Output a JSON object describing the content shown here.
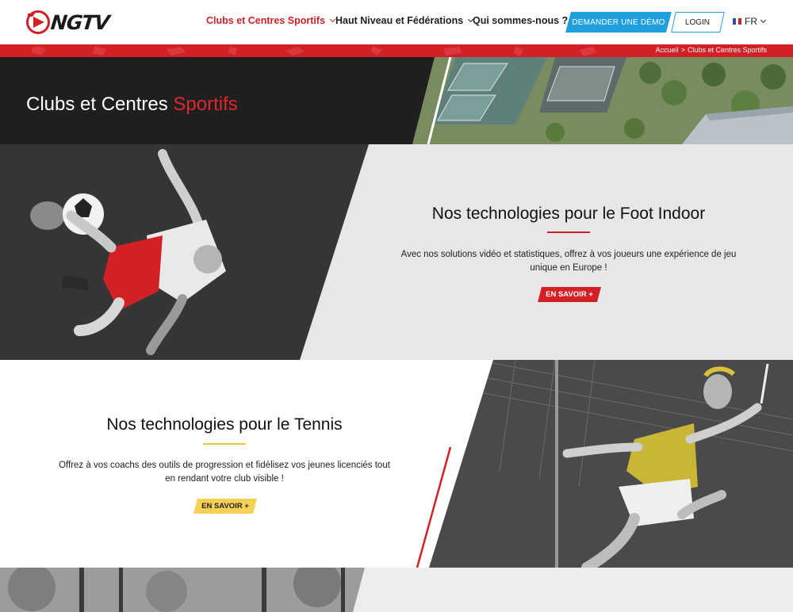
{
  "header": {
    "logo_text": "NGTV",
    "nav": [
      {
        "label": "Clubs et Centres Sportifs",
        "active": true,
        "has_dropdown": true
      },
      {
        "label": "Haut Niveau et Fédérations",
        "active": false,
        "has_dropdown": true
      },
      {
        "label": "Qui sommes-nous ?",
        "active": false,
        "has_dropdown": false
      }
    ],
    "demo_button": "DEMANDER UNE DÉMO",
    "login_button": "LOGIN",
    "language": "FR"
  },
  "breadcrumb": {
    "home": "Accueil",
    "separator": ">",
    "current": "Clubs et Centres Sportifs"
  },
  "hero": {
    "title_main": "Clubs et Centres",
    "title_accent": "Sportifs"
  },
  "sections": [
    {
      "id": "foot-indoor",
      "title": "Nos technologies pour le Foot Indoor",
      "text_line1": "Avec nos solutions vidéo et statistiques, offrez à vos joueurs une expérience de jeu",
      "text_line2": "unique en Europe !",
      "cta": "EN SAVOIR +",
      "accent_color": "#d32027"
    },
    {
      "id": "tennis",
      "title": "Nos technologies pour le Tennis",
      "text_line1": "Offrez à vos coachs des outils de progression et fidélisez vos jeunes licenciés tout",
      "text_line2": "en rendant votre club visible !",
      "cta": "EN SAVOIR +",
      "accent_color": "#f6d155"
    }
  ],
  "colors": {
    "brand_red": "#d32027",
    "brand_blue": "#1f9fe0",
    "tennis_yellow": "#f6d155",
    "dark": "#1f1f1f"
  }
}
